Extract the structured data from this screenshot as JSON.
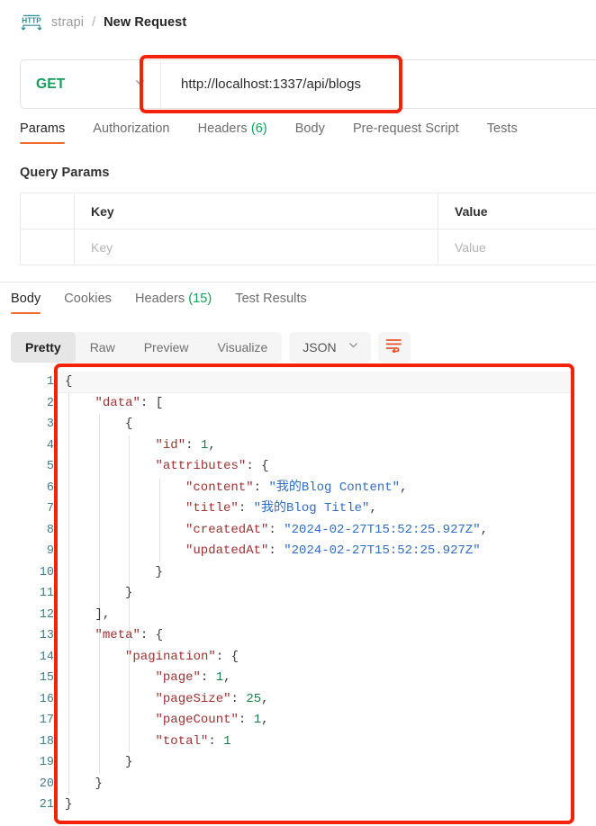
{
  "breadcrumb": {
    "icon": "http-protocol-icon",
    "collection": "strapi",
    "separator": "/",
    "current": "New Request"
  },
  "request": {
    "method": "GET",
    "method_color": "#10a05a",
    "url": "http://localhost:1337/api/blogs",
    "tabs": [
      {
        "label": "Params",
        "active": true
      },
      {
        "label": "Authorization",
        "active": false
      },
      {
        "label": "Headers",
        "count": "(6)",
        "active": false
      },
      {
        "label": "Body",
        "active": false
      },
      {
        "label": "Pre-request Script",
        "active": false
      },
      {
        "label": "Tests",
        "active": false
      }
    ],
    "query_params": {
      "title": "Query Params",
      "headers": {
        "key": "Key",
        "value": "Value"
      },
      "rows": [
        {
          "key_placeholder": "Key",
          "value_placeholder": "Value"
        }
      ]
    }
  },
  "response": {
    "tabs": [
      {
        "label": "Body",
        "active": true
      },
      {
        "label": "Cookies",
        "active": false
      },
      {
        "label": "Headers",
        "count": "(15)",
        "active": false
      },
      {
        "label": "Test Results",
        "active": false
      }
    ],
    "view_modes": [
      {
        "label": "Pretty",
        "active": true
      },
      {
        "label": "Raw",
        "active": false
      },
      {
        "label": "Preview",
        "active": false
      },
      {
        "label": "Visualize",
        "active": false
      }
    ],
    "language": "JSON",
    "wrap_icon": "word-wrap-icon"
  },
  "accent": {
    "tab_underline": "#ef6c2e",
    "annotation_red": "#f4210b",
    "count_green": "#10a05a",
    "line_number": "#3f7d8c",
    "json_key": "#a03232",
    "json_string": "#2f6ec4",
    "json_number": "#18814a"
  },
  "json_body": {
    "total_lines": 21,
    "lines": [
      {
        "n": 1,
        "indent": 0,
        "tokens": [
          {
            "t": "pun",
            "v": "{"
          }
        ]
      },
      {
        "n": 2,
        "indent": 1,
        "tokens": [
          {
            "t": "key",
            "v": "\"data\""
          },
          {
            "t": "pun",
            "v": ": ["
          }
        ]
      },
      {
        "n": 3,
        "indent": 2,
        "tokens": [
          {
            "t": "pun",
            "v": "{"
          }
        ]
      },
      {
        "n": 4,
        "indent": 3,
        "tokens": [
          {
            "t": "key",
            "v": "\"id\""
          },
          {
            "t": "pun",
            "v": ": "
          },
          {
            "t": "num",
            "v": "1"
          },
          {
            "t": "pun",
            "v": ","
          }
        ]
      },
      {
        "n": 5,
        "indent": 3,
        "tokens": [
          {
            "t": "key",
            "v": "\"attributes\""
          },
          {
            "t": "pun",
            "v": ": {"
          }
        ]
      },
      {
        "n": 6,
        "indent": 4,
        "tokens": [
          {
            "t": "key",
            "v": "\"content\""
          },
          {
            "t": "pun",
            "v": ": "
          },
          {
            "t": "str",
            "v": "\"我的Blog Content\""
          },
          {
            "t": "pun",
            "v": ","
          }
        ]
      },
      {
        "n": 7,
        "indent": 4,
        "tokens": [
          {
            "t": "key",
            "v": "\"title\""
          },
          {
            "t": "pun",
            "v": ": "
          },
          {
            "t": "str",
            "v": "\"我的Blog Title\""
          },
          {
            "t": "pun",
            "v": ","
          }
        ]
      },
      {
        "n": 8,
        "indent": 4,
        "tokens": [
          {
            "t": "key",
            "v": "\"createdAt\""
          },
          {
            "t": "pun",
            "v": ": "
          },
          {
            "t": "str",
            "v": "\"2024-02-27T15:52:25.927Z\""
          },
          {
            "t": "pun",
            "v": ","
          }
        ]
      },
      {
        "n": 9,
        "indent": 4,
        "tokens": [
          {
            "t": "key",
            "v": "\"updatedAt\""
          },
          {
            "t": "pun",
            "v": ": "
          },
          {
            "t": "str",
            "v": "\"2024-02-27T15:52:25.927Z\""
          }
        ]
      },
      {
        "n": 10,
        "indent": 3,
        "tokens": [
          {
            "t": "pun",
            "v": "}"
          }
        ]
      },
      {
        "n": 11,
        "indent": 2,
        "tokens": [
          {
            "t": "pun",
            "v": "}"
          }
        ]
      },
      {
        "n": 12,
        "indent": 1,
        "tokens": [
          {
            "t": "pun",
            "v": "],"
          }
        ]
      },
      {
        "n": 13,
        "indent": 1,
        "tokens": [
          {
            "t": "key",
            "v": "\"meta\""
          },
          {
            "t": "pun",
            "v": ": {"
          }
        ]
      },
      {
        "n": 14,
        "indent": 2,
        "tokens": [
          {
            "t": "key",
            "v": "\"pagination\""
          },
          {
            "t": "pun",
            "v": ": {"
          }
        ]
      },
      {
        "n": 15,
        "indent": 3,
        "tokens": [
          {
            "t": "key",
            "v": "\"page\""
          },
          {
            "t": "pun",
            "v": ": "
          },
          {
            "t": "num",
            "v": "1"
          },
          {
            "t": "pun",
            "v": ","
          }
        ]
      },
      {
        "n": 16,
        "indent": 3,
        "tokens": [
          {
            "t": "key",
            "v": "\"pageSize\""
          },
          {
            "t": "pun",
            "v": ": "
          },
          {
            "t": "num",
            "v": "25"
          },
          {
            "t": "pun",
            "v": ","
          }
        ]
      },
      {
        "n": 17,
        "indent": 3,
        "tokens": [
          {
            "t": "key",
            "v": "\"pageCount\""
          },
          {
            "t": "pun",
            "v": ": "
          },
          {
            "t": "num",
            "v": "1"
          },
          {
            "t": "pun",
            "v": ","
          }
        ]
      },
      {
        "n": 18,
        "indent": 3,
        "tokens": [
          {
            "t": "key",
            "v": "\"total\""
          },
          {
            "t": "pun",
            "v": ": "
          },
          {
            "t": "num",
            "v": "1"
          }
        ]
      },
      {
        "n": 19,
        "indent": 2,
        "tokens": [
          {
            "t": "pun",
            "v": "}"
          }
        ]
      },
      {
        "n": 20,
        "indent": 1,
        "tokens": [
          {
            "t": "pun",
            "v": "}"
          }
        ]
      },
      {
        "n": 21,
        "indent": 0,
        "tokens": [
          {
            "t": "pun",
            "v": "}"
          }
        ]
      }
    ],
    "parsed": {
      "data": [
        {
          "id": 1,
          "attributes": {
            "content": "我的Blog Content",
            "title": "我的Blog Title",
            "createdAt": "2024-02-27T15:52:25.927Z",
            "updatedAt": "2024-02-27T15:52:25.927Z"
          }
        }
      ],
      "meta": {
        "pagination": {
          "page": 1,
          "pageSize": 25,
          "pageCount": 1,
          "total": 1
        }
      }
    }
  }
}
